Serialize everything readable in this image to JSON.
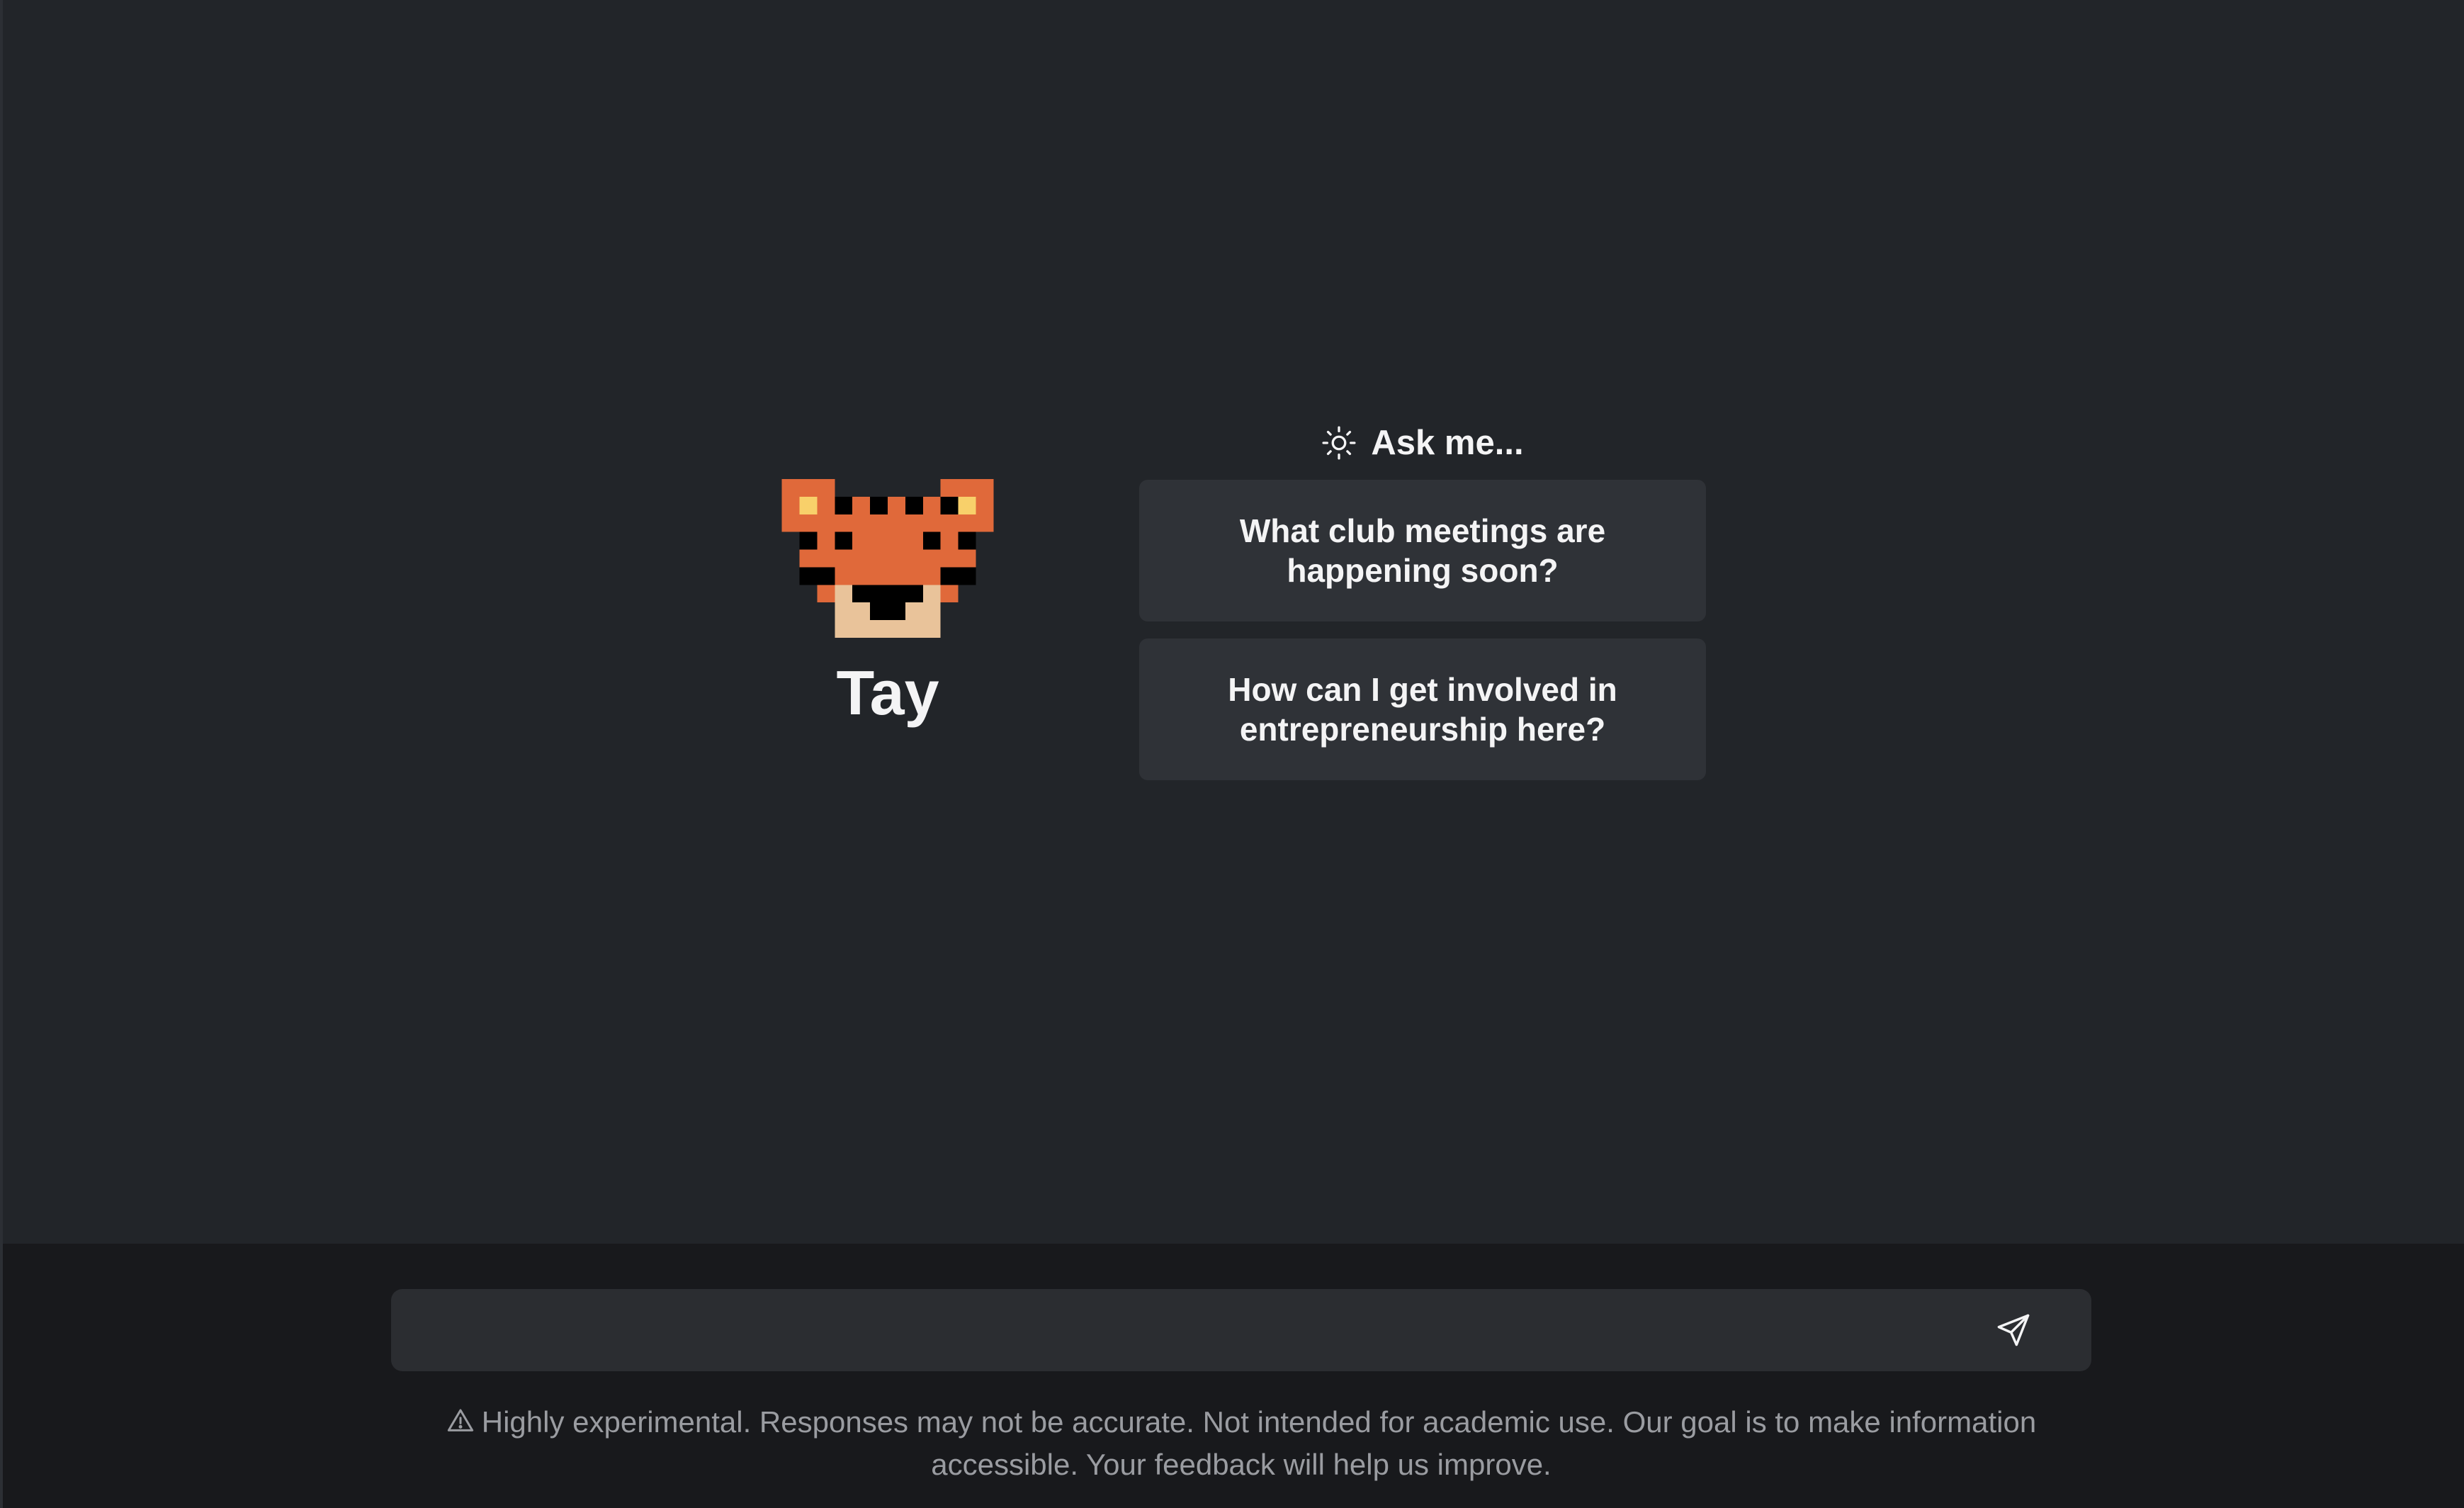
{
  "assistant": {
    "name": "Tay",
    "mascot_icon": "pixel-tiger-icon",
    "colors": {
      "orange": "#e0693a",
      "cream": "#e9c39a",
      "eye_yellow": "#f8d06a",
      "stripe": "#000000"
    }
  },
  "prompts": {
    "heading": "Ask me...",
    "heading_icon": "sun-icon",
    "suggestions": [
      "What club meetings are happening soon?",
      "How can I get involved in entrepreneurship here?"
    ]
  },
  "composer": {
    "placeholder": "",
    "value": "",
    "send_icon": "send-icon"
  },
  "footer": {
    "warning_icon": "warning-icon",
    "disclaimer": "Highly experimental. Responses may not be accurate. Not intended for academic use. Our goal is to make information accessible. Your feedback will help us improve."
  },
  "theme": {
    "background": "#222529",
    "footer_background": "#18191c",
    "card_background": "#2f3237",
    "muted_text": "#9a9ca1"
  }
}
